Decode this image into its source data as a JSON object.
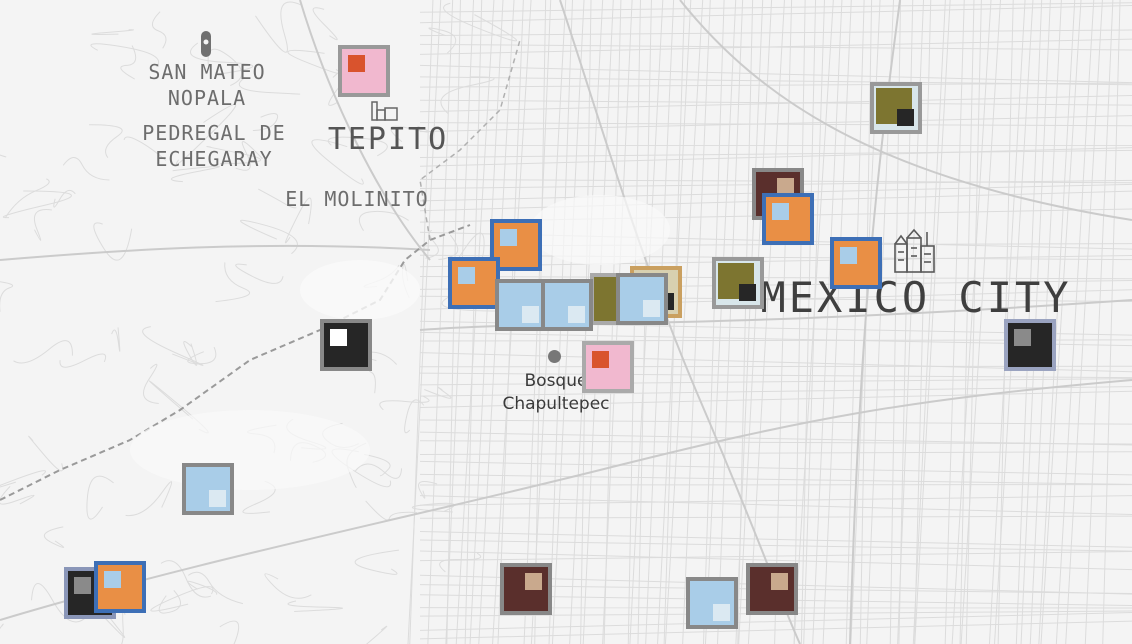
{
  "map": {
    "labels": [
      {
        "text": "SAN MATEO\nNOPALA",
        "size": "small"
      },
      {
        "text": "PEDREGAL DE\nECHEGARAY",
        "size": "small"
      },
      {
        "text": "EL MOLINITO",
        "size": "small"
      },
      {
        "text": "TEPITO",
        "size": "big"
      },
      {
        "text": "MEXICO CITY",
        "size": "city"
      }
    ],
    "poi": {
      "label": "Bosque\nChapultepec",
      "icon": "park-dot-icon"
    },
    "icons": [
      "map-pin-icon",
      "factory-icon",
      "city-buildings-icon"
    ]
  },
  "palette": {
    "map_bg": "#f4f4f4",
    "road": "#d9d9d9",
    "road_major": "#cfcfcf",
    "border_blue": "#3d6fb6",
    "border_gray": "#8a8a8a",
    "orange": "#e98f45",
    "light_blue": "#a9cde8",
    "pink": "#f1b8cf",
    "red": "#d9532d",
    "olive": "#7d7530",
    "dark": "#262626",
    "maroon": "#5a2f2c",
    "beige": "#c9a98d"
  }
}
